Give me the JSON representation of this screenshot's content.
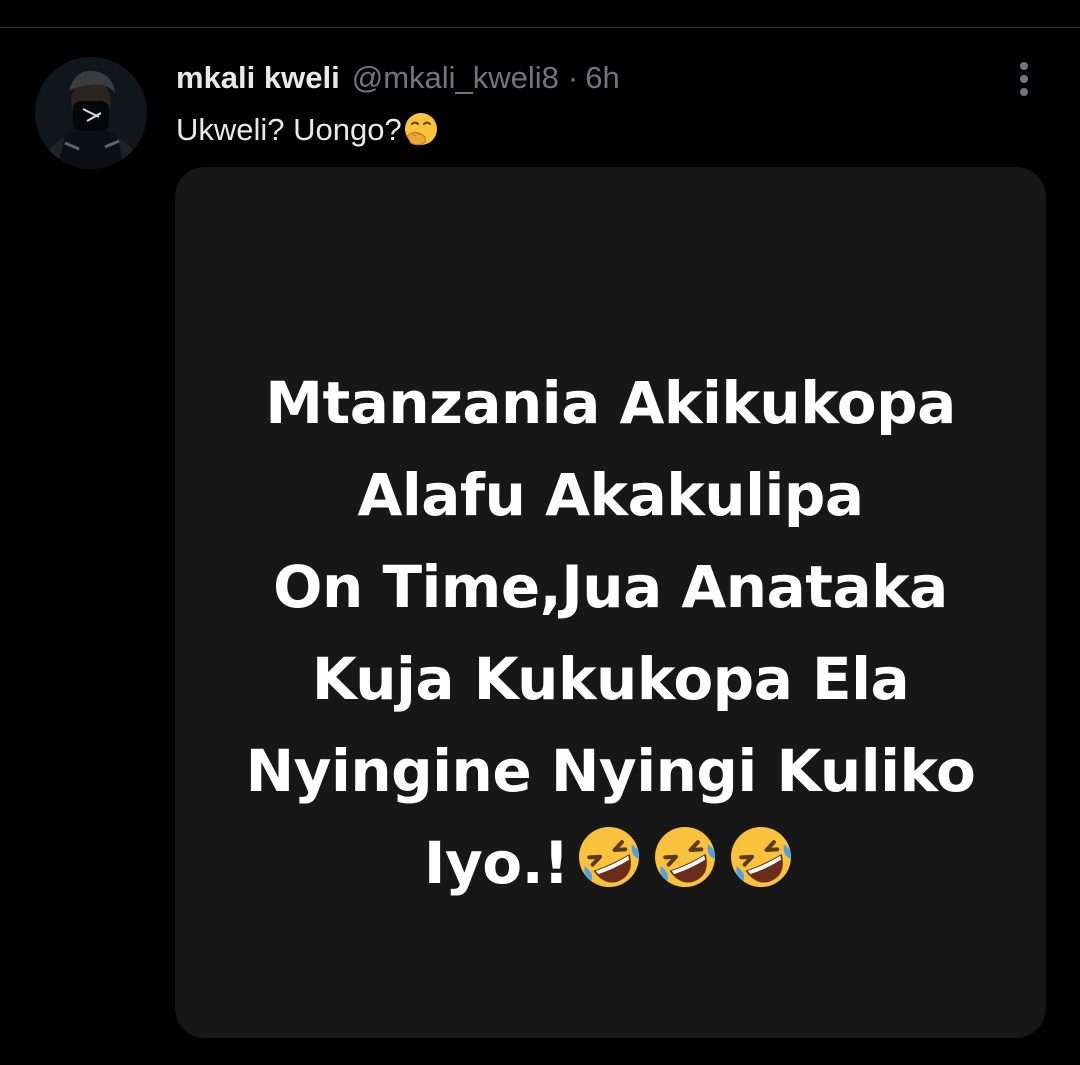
{
  "tweet": {
    "author": {
      "display_name": "mkali kweli",
      "handle": "@mkali_kweli8"
    },
    "separator": "·",
    "time_ago": "6h",
    "text": "Ukweli? Uongo?",
    "text_emoji": "face-with-hand-over-mouth",
    "media": {
      "lines": [
        "Mtanzania Akikukopa",
        "Alafu Akakulipa",
        "On Time,Jua Anataka",
        "Kuja Kukukopa Ela",
        "Nyingine Nyingi Kuliko",
        "Iyo.!"
      ],
      "trailing_emoji": "rolling-on-the-floor-laughing",
      "trailing_emoji_count": 3
    }
  },
  "colors": {
    "background": "#000000",
    "card_background": "#171717",
    "primary_text": "#e7e9ea",
    "secondary_text": "#71767b",
    "divider": "#2f3336",
    "emoji_yellow": "#f9c23c"
  }
}
